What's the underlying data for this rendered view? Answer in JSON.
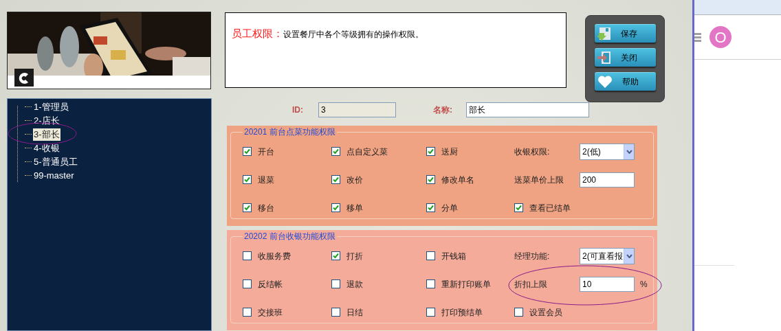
{
  "tree": {
    "items": [
      {
        "label": "1-管理员",
        "selected": false
      },
      {
        "label": "2-店长",
        "selected": false
      },
      {
        "label": "3-部长",
        "selected": true
      },
      {
        "label": "4-收银",
        "selected": false
      },
      {
        "label": "5-普通员工",
        "selected": false
      },
      {
        "label": "99-master",
        "selected": false
      }
    ]
  },
  "description": {
    "title": "员工权限：",
    "text": "设置餐厅中各个等级拥有的操作权限。"
  },
  "buttons": [
    {
      "kind": "save",
      "label": "保存"
    },
    {
      "kind": "close",
      "label": "关闭"
    },
    {
      "kind": "help",
      "label": "帮助"
    }
  ],
  "fields": {
    "id_label": "ID:",
    "id_value": "3",
    "name_label": "名称:",
    "name_value": "部长"
  },
  "sections": [
    {
      "legend": "20201 前台点菜功能权限",
      "items": [
        {
          "kind": "checkbox",
          "label": "开台",
          "checked": true
        },
        {
          "kind": "checkbox",
          "label": "点自定义菜",
          "checked": true
        },
        {
          "kind": "checkbox",
          "label": "送厨",
          "checked": true
        },
        {
          "kind": "select",
          "label": "收银权限:",
          "value": "2(低)"
        },
        {
          "kind": "checkbox",
          "label": "退菜",
          "checked": true
        },
        {
          "kind": "checkbox",
          "label": "改价",
          "checked": true
        },
        {
          "kind": "checkbox",
          "label": "修改单名",
          "checked": true
        },
        {
          "kind": "input",
          "label": "送菜单价上限",
          "value": "200"
        },
        {
          "kind": "checkbox",
          "label": "移台",
          "checked": true
        },
        {
          "kind": "checkbox",
          "label": "移单",
          "checked": true
        },
        {
          "kind": "checkbox",
          "label": "分单",
          "checked": true
        },
        {
          "kind": "checkbox",
          "label": "查看已结单",
          "checked": true
        }
      ]
    },
    {
      "legend": "20202 前台收银功能权限",
      "items": [
        {
          "kind": "checkbox",
          "label": "收服务费",
          "checked": false
        },
        {
          "kind": "checkbox",
          "label": "打折",
          "checked": true
        },
        {
          "kind": "checkbox",
          "label": "开钱箱",
          "checked": false
        },
        {
          "kind": "select",
          "label": "经理功能:",
          "value": "2(可直看报"
        },
        {
          "kind": "checkbox",
          "label": "反结帐",
          "checked": false
        },
        {
          "kind": "checkbox",
          "label": "退款",
          "checked": false
        },
        {
          "kind": "checkbox",
          "label": "重新打印账单",
          "checked": false
        },
        {
          "kind": "input",
          "label": "折扣上限",
          "value": "10",
          "suffix": "%"
        },
        {
          "kind": "checkbox",
          "label": "交接班",
          "checked": false
        },
        {
          "kind": "checkbox",
          "label": "日结",
          "checked": false
        },
        {
          "kind": "checkbox",
          "label": "打印预结单",
          "checked": false
        },
        {
          "kind": "checkbox",
          "label": "设置会员",
          "checked": false
        }
      ]
    }
  ],
  "side_pane": {
    "avatar": "O"
  }
}
